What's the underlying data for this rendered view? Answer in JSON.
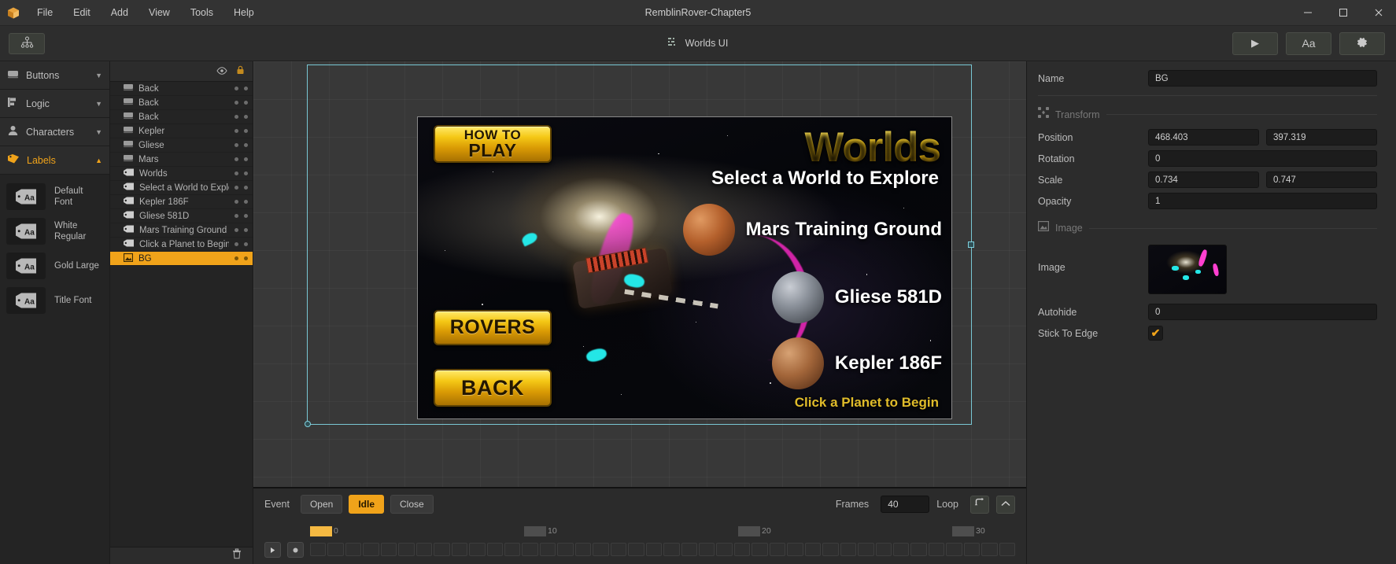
{
  "titlebar": {
    "logo_icon": "package-icon",
    "menu": [
      "File",
      "Edit",
      "Add",
      "View",
      "Tools",
      "Help"
    ],
    "window_title": "RemblinRover-Chapter5",
    "minimize": "—",
    "maximize": "☐",
    "close": "✕"
  },
  "toolbar": {
    "hierarchy_icon": "hierarchy-tree-icon",
    "scene_icon": "list-icon",
    "scene_label": "Worlds UI",
    "play_icon": "▶",
    "font_label": "Aa",
    "settings_icon": "gear-icon"
  },
  "left_panel": {
    "categories": [
      {
        "label": "Buttons",
        "icon": "button-icon",
        "expanded": false
      },
      {
        "label": "Logic",
        "icon": "logic-node-icon",
        "expanded": false
      },
      {
        "label": "Characters",
        "icon": "person-icon",
        "expanded": false
      },
      {
        "label": "Labels",
        "icon": "tag-icon",
        "expanded": true
      }
    ],
    "assets": [
      {
        "name": "Default Font",
        "icon": "label-aa-icon"
      },
      {
        "name": "White Regular",
        "icon": "label-aa-icon"
      },
      {
        "name": "Gold Large",
        "icon": "label-aa-icon"
      },
      {
        "name": "Title Font",
        "icon": "label-aa-icon"
      }
    ]
  },
  "layers": {
    "eye_icon": "eye-icon",
    "lock_icon": "lock-icon",
    "delete_icon": "trash-icon",
    "items": [
      {
        "name": "Back",
        "type": "button",
        "selected": false
      },
      {
        "name": "Back",
        "type": "button",
        "selected": false
      },
      {
        "name": "Back",
        "type": "button",
        "selected": false
      },
      {
        "name": "Kepler",
        "type": "button",
        "selected": false
      },
      {
        "name": "Gliese",
        "type": "button",
        "selected": false
      },
      {
        "name": "Mars",
        "type": "button",
        "selected": false
      },
      {
        "name": "Worlds",
        "type": "label",
        "selected": false
      },
      {
        "name": "Select a World to Explore",
        "type": "label",
        "selected": false
      },
      {
        "name": "Kepler 186F",
        "type": "label",
        "selected": false
      },
      {
        "name": "Gliese 581D",
        "type": "label",
        "selected": false
      },
      {
        "name": "Mars Training Ground",
        "type": "label",
        "selected": false
      },
      {
        "name": "Click a Planet to Begin",
        "type": "label",
        "selected": false
      },
      {
        "name": "BG",
        "type": "image",
        "selected": true
      }
    ]
  },
  "canvas": {
    "buttons": {
      "how_to_line1": "HOW TO",
      "how_to_line2": "PLAY",
      "rovers": "ROVERS",
      "back": "BACK"
    },
    "title": "Worlds",
    "subtitle": "Select a World to Explore",
    "worlds": [
      {
        "name": "Mars Training Ground",
        "planet": "mars"
      },
      {
        "name": "Gliese 581D",
        "planet": "gliese"
      },
      {
        "name": "Kepler 186F",
        "planet": "kepler"
      }
    ],
    "hint": "Click a Planet to Begin"
  },
  "timeline": {
    "event_label": "Event",
    "events": [
      {
        "label": "Open",
        "active": false
      },
      {
        "label": "Idle",
        "active": true
      },
      {
        "label": "Close",
        "active": false
      }
    ],
    "play_icon": "▶",
    "record_icon": "record-icon",
    "frames_label": "Frames",
    "frames_value": "40",
    "loop_label": "Loop",
    "loop_icon": "loop-arrow-icon",
    "collapse_icon": "chevron-up-icon",
    "ruler_labels": [
      "0",
      "10",
      "20",
      "30"
    ]
  },
  "inspector": {
    "name_label": "Name",
    "name_value": "BG",
    "transform": {
      "icon": "transform-icon",
      "title": "Transform",
      "position_label": "Position",
      "position_x": "468.403",
      "position_y": "397.319",
      "rotation_label": "Rotation",
      "rotation_value": "0",
      "scale_label": "Scale",
      "scale_x": "0.734",
      "scale_y": "0.747",
      "opacity_label": "Opacity",
      "opacity_value": "1"
    },
    "image": {
      "icon": "image-icon",
      "title": "Image",
      "image_label": "Image",
      "autohide_label": "Autohide",
      "autohide_value": "0",
      "stick_label": "Stick To Edge",
      "stick_checked": "✔"
    }
  },
  "colors": {
    "accent": "#f0a31a",
    "selection": "#79c7d4",
    "gold": "#f0c21a"
  }
}
